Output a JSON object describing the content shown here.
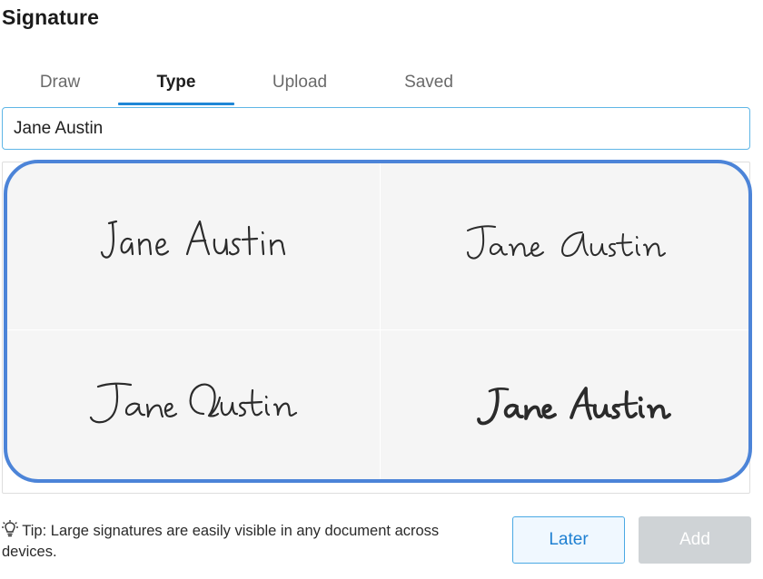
{
  "dialog": {
    "title": "Signature"
  },
  "tabs": [
    {
      "label": "Draw",
      "active": false
    },
    {
      "label": "Type",
      "active": true
    },
    {
      "label": "Upload",
      "active": false
    },
    {
      "label": "Saved",
      "active": false
    }
  ],
  "name_input": {
    "value": "Jane Austin",
    "placeholder": ""
  },
  "signature_options": [
    {
      "text": "Jane Austin",
      "style": "handwritten-print"
    },
    {
      "text": "Jane Austin",
      "style": "cursive-thin"
    },
    {
      "text": "Jane Austin",
      "style": "script-flourish"
    },
    {
      "text": "Jane Austin",
      "style": "brush-bold"
    }
  ],
  "tip": {
    "icon": "lightbulb-icon",
    "text": "Tip: Large signatures are easily visible in any document across devices."
  },
  "buttons": {
    "later": "Later",
    "add": "Add"
  },
  "colors": {
    "accent": "#1f86d6",
    "selection_outline": "#4c84d8",
    "button_disabled": "#cfd3d6",
    "signature_ink": "#2b2b2b"
  }
}
